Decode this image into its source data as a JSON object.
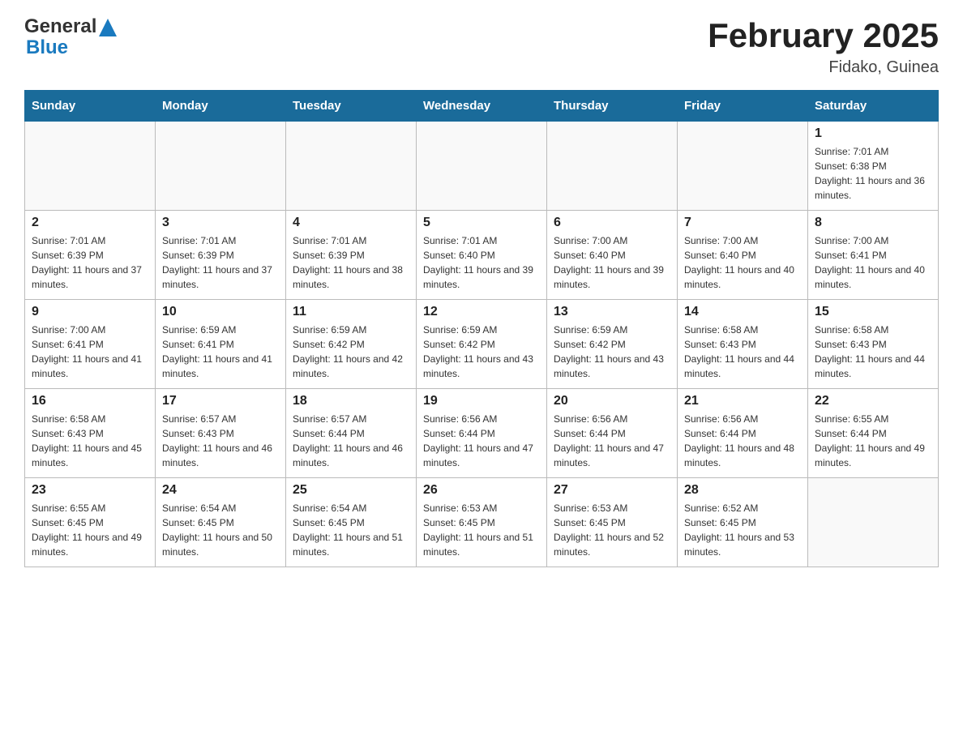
{
  "header": {
    "logo_general": "General",
    "logo_blue": "Blue",
    "month_title": "February 2025",
    "location": "Fidako, Guinea"
  },
  "weekdays": [
    "Sunday",
    "Monday",
    "Tuesday",
    "Wednesday",
    "Thursday",
    "Friday",
    "Saturday"
  ],
  "weeks": [
    [
      {
        "day": "",
        "sunrise": "",
        "sunset": "",
        "daylight": ""
      },
      {
        "day": "",
        "sunrise": "",
        "sunset": "",
        "daylight": ""
      },
      {
        "day": "",
        "sunrise": "",
        "sunset": "",
        "daylight": ""
      },
      {
        "day": "",
        "sunrise": "",
        "sunset": "",
        "daylight": ""
      },
      {
        "day": "",
        "sunrise": "",
        "sunset": "",
        "daylight": ""
      },
      {
        "day": "",
        "sunrise": "",
        "sunset": "",
        "daylight": ""
      },
      {
        "day": "1",
        "sunrise": "Sunrise: 7:01 AM",
        "sunset": "Sunset: 6:38 PM",
        "daylight": "Daylight: 11 hours and 36 minutes."
      }
    ],
    [
      {
        "day": "2",
        "sunrise": "Sunrise: 7:01 AM",
        "sunset": "Sunset: 6:39 PM",
        "daylight": "Daylight: 11 hours and 37 minutes."
      },
      {
        "day": "3",
        "sunrise": "Sunrise: 7:01 AM",
        "sunset": "Sunset: 6:39 PM",
        "daylight": "Daylight: 11 hours and 37 minutes."
      },
      {
        "day": "4",
        "sunrise": "Sunrise: 7:01 AM",
        "sunset": "Sunset: 6:39 PM",
        "daylight": "Daylight: 11 hours and 38 minutes."
      },
      {
        "day": "5",
        "sunrise": "Sunrise: 7:01 AM",
        "sunset": "Sunset: 6:40 PM",
        "daylight": "Daylight: 11 hours and 39 minutes."
      },
      {
        "day": "6",
        "sunrise": "Sunrise: 7:00 AM",
        "sunset": "Sunset: 6:40 PM",
        "daylight": "Daylight: 11 hours and 39 minutes."
      },
      {
        "day": "7",
        "sunrise": "Sunrise: 7:00 AM",
        "sunset": "Sunset: 6:40 PM",
        "daylight": "Daylight: 11 hours and 40 minutes."
      },
      {
        "day": "8",
        "sunrise": "Sunrise: 7:00 AM",
        "sunset": "Sunset: 6:41 PM",
        "daylight": "Daylight: 11 hours and 40 minutes."
      }
    ],
    [
      {
        "day": "9",
        "sunrise": "Sunrise: 7:00 AM",
        "sunset": "Sunset: 6:41 PM",
        "daylight": "Daylight: 11 hours and 41 minutes."
      },
      {
        "day": "10",
        "sunrise": "Sunrise: 6:59 AM",
        "sunset": "Sunset: 6:41 PM",
        "daylight": "Daylight: 11 hours and 41 minutes."
      },
      {
        "day": "11",
        "sunrise": "Sunrise: 6:59 AM",
        "sunset": "Sunset: 6:42 PM",
        "daylight": "Daylight: 11 hours and 42 minutes."
      },
      {
        "day": "12",
        "sunrise": "Sunrise: 6:59 AM",
        "sunset": "Sunset: 6:42 PM",
        "daylight": "Daylight: 11 hours and 43 minutes."
      },
      {
        "day": "13",
        "sunrise": "Sunrise: 6:59 AM",
        "sunset": "Sunset: 6:42 PM",
        "daylight": "Daylight: 11 hours and 43 minutes."
      },
      {
        "day": "14",
        "sunrise": "Sunrise: 6:58 AM",
        "sunset": "Sunset: 6:43 PM",
        "daylight": "Daylight: 11 hours and 44 minutes."
      },
      {
        "day": "15",
        "sunrise": "Sunrise: 6:58 AM",
        "sunset": "Sunset: 6:43 PM",
        "daylight": "Daylight: 11 hours and 44 minutes."
      }
    ],
    [
      {
        "day": "16",
        "sunrise": "Sunrise: 6:58 AM",
        "sunset": "Sunset: 6:43 PM",
        "daylight": "Daylight: 11 hours and 45 minutes."
      },
      {
        "day": "17",
        "sunrise": "Sunrise: 6:57 AM",
        "sunset": "Sunset: 6:43 PM",
        "daylight": "Daylight: 11 hours and 46 minutes."
      },
      {
        "day": "18",
        "sunrise": "Sunrise: 6:57 AM",
        "sunset": "Sunset: 6:44 PM",
        "daylight": "Daylight: 11 hours and 46 minutes."
      },
      {
        "day": "19",
        "sunrise": "Sunrise: 6:56 AM",
        "sunset": "Sunset: 6:44 PM",
        "daylight": "Daylight: 11 hours and 47 minutes."
      },
      {
        "day": "20",
        "sunrise": "Sunrise: 6:56 AM",
        "sunset": "Sunset: 6:44 PM",
        "daylight": "Daylight: 11 hours and 47 minutes."
      },
      {
        "day": "21",
        "sunrise": "Sunrise: 6:56 AM",
        "sunset": "Sunset: 6:44 PM",
        "daylight": "Daylight: 11 hours and 48 minutes."
      },
      {
        "day": "22",
        "sunrise": "Sunrise: 6:55 AM",
        "sunset": "Sunset: 6:44 PM",
        "daylight": "Daylight: 11 hours and 49 minutes."
      }
    ],
    [
      {
        "day": "23",
        "sunrise": "Sunrise: 6:55 AM",
        "sunset": "Sunset: 6:45 PM",
        "daylight": "Daylight: 11 hours and 49 minutes."
      },
      {
        "day": "24",
        "sunrise": "Sunrise: 6:54 AM",
        "sunset": "Sunset: 6:45 PM",
        "daylight": "Daylight: 11 hours and 50 minutes."
      },
      {
        "day": "25",
        "sunrise": "Sunrise: 6:54 AM",
        "sunset": "Sunset: 6:45 PM",
        "daylight": "Daylight: 11 hours and 51 minutes."
      },
      {
        "day": "26",
        "sunrise": "Sunrise: 6:53 AM",
        "sunset": "Sunset: 6:45 PM",
        "daylight": "Daylight: 11 hours and 51 minutes."
      },
      {
        "day": "27",
        "sunrise": "Sunrise: 6:53 AM",
        "sunset": "Sunset: 6:45 PM",
        "daylight": "Daylight: 11 hours and 52 minutes."
      },
      {
        "day": "28",
        "sunrise": "Sunrise: 6:52 AM",
        "sunset": "Sunset: 6:45 PM",
        "daylight": "Daylight: 11 hours and 53 minutes."
      },
      {
        "day": "",
        "sunrise": "",
        "sunset": "",
        "daylight": ""
      }
    ]
  ]
}
